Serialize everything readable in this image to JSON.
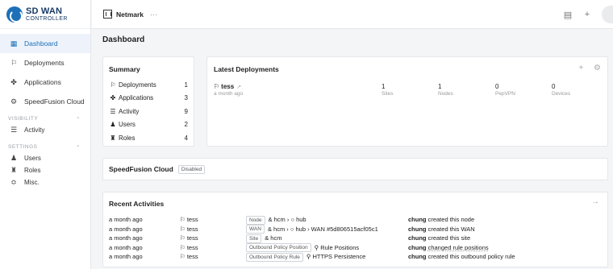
{
  "brand": {
    "line1": "SD WAN",
    "line2": "CONTROLLER"
  },
  "topbar": {
    "org_name": "Netmark",
    "more": "···",
    "icon_message": "message-icon",
    "icon_add": "+"
  },
  "nav": {
    "dashboard": "Dashboard",
    "deployments": "Deployments",
    "applications": "Applications",
    "speedfusion": "SpeedFusion Cloud",
    "visibility_section": "VISIBILITY",
    "activity": "Activity",
    "settings_section": "SETTINGS",
    "users": "Users",
    "roles": "Roles",
    "misc": "Misc."
  },
  "page": {
    "title": "Dashboard"
  },
  "summary": {
    "title": "Summary",
    "rows": [
      {
        "label": "Deployments",
        "count": "1",
        "icon": "flag-icon"
      },
      {
        "label": "Applications",
        "count": "3",
        "icon": "apps-icon"
      },
      {
        "label": "Activity",
        "count": "9",
        "icon": "activity-icon"
      },
      {
        "label": "Users",
        "count": "2",
        "icon": "user-icon"
      },
      {
        "label": "Roles",
        "count": "4",
        "icon": "roles-icon"
      }
    ]
  },
  "latest": {
    "title": "Latest Deployments",
    "deployment": {
      "name": "tess",
      "time": "a month ago",
      "stats": [
        {
          "value": "1",
          "label": "Sites"
        },
        {
          "value": "1",
          "label": "Nodes"
        },
        {
          "value": "0",
          "label": "PepVPN"
        },
        {
          "value": "0",
          "label": "Devices"
        }
      ]
    }
  },
  "speedfusion": {
    "title": "SpeedFusion Cloud",
    "status": "Disabled"
  },
  "recent": {
    "title": "Recent Activities",
    "rows": [
      {
        "time": "a month ago",
        "user": "tess",
        "tag": "Node",
        "object": "& hcm › ○ hub",
        "actor": "chung",
        "action": "created this node"
      },
      {
        "time": "a month ago",
        "user": "tess",
        "tag": "WAN",
        "object": "& hcm › ○ hub › WAN #5d806515acf05c1",
        "actor": "chung",
        "action": "created this WAN"
      },
      {
        "time": "a month ago",
        "user": "tess",
        "tag": "Site",
        "object": "& hcm",
        "actor": "chung",
        "action": "created this site"
      },
      {
        "time": "a month ago",
        "user": "tess",
        "tag": "Outbound Policy Position",
        "object": "Rule Positions",
        "actor": "chung",
        "action": "changed rule positions"
      },
      {
        "time": "a month ago",
        "user": "tess",
        "tag": "Outbound Policy Rule",
        "object": "HTTPS Persistence",
        "actor": "chung",
        "action": "created this outbound policy rule"
      }
    ]
  }
}
